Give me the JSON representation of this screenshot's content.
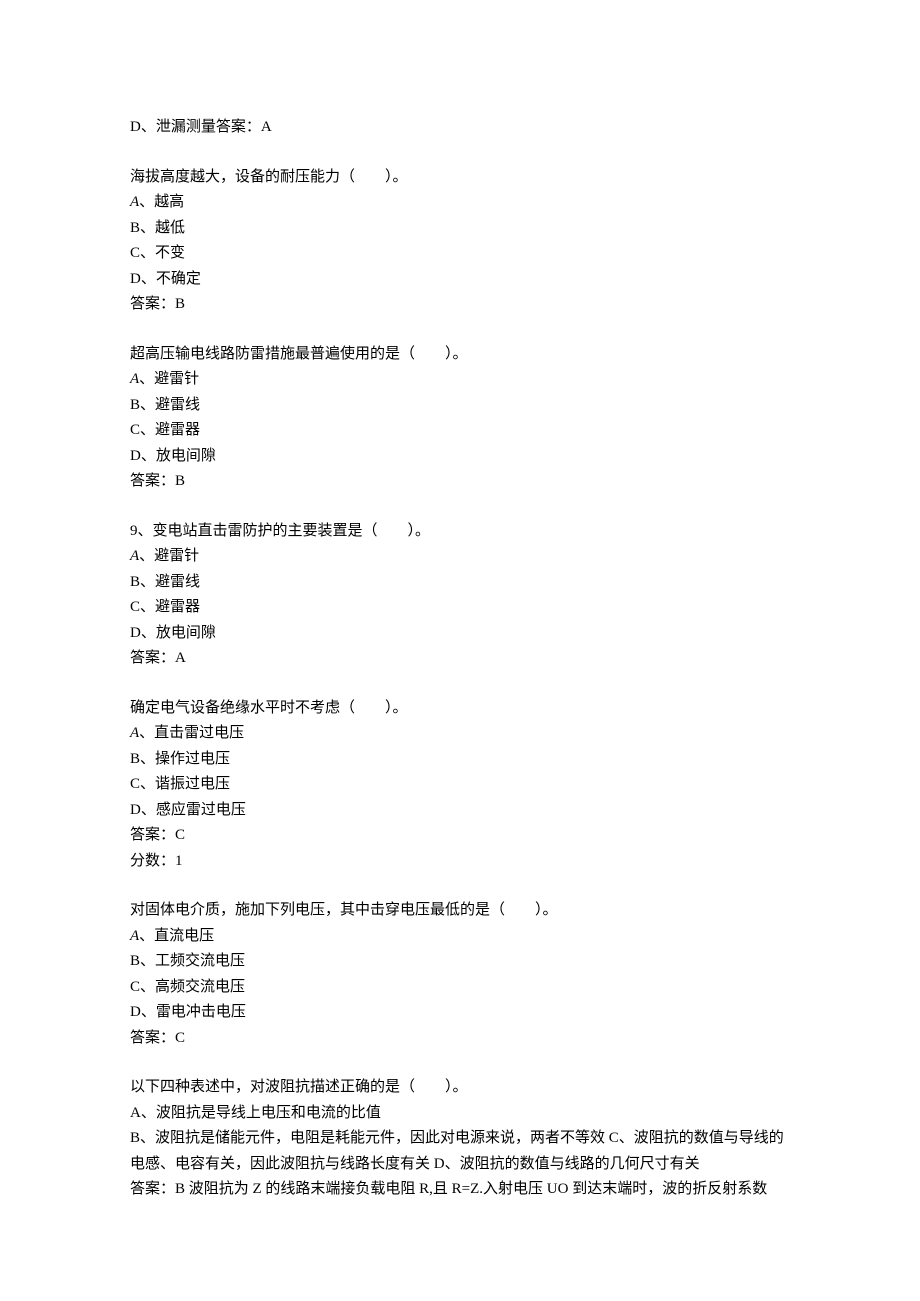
{
  "q1_tail": {
    "optD": "D、泄漏测量答案：A"
  },
  "q2": {
    "stem": "海拔高度越大，设备的耐压能力（　　）。",
    "optA_letter": "A",
    "optA_text": "、越高",
    "optB": "B、越低",
    "optC": "C、不变",
    "optD": "D、不确定",
    "answer": "答案：B"
  },
  "q3": {
    "stem": "超高压输电线路防雷措施最普遍使用的是（　　）。",
    "optA_letter": "A",
    "optA_text": "、避雷针",
    "optB": "B、避雷线",
    "optC": "C、避雷器",
    "optD": "D、放电间隙",
    "answer": "答案：B"
  },
  "q4": {
    "stem": "9、变电站直击雷防护的主要装置是（　　）。",
    "optA_letter": "A",
    "optA_text": "、避雷针",
    "optB": "B、避雷线",
    "optC": "C、避雷器",
    "optD": "D、放电间隙",
    "answer": "答案：A"
  },
  "q5": {
    "stem": "确定电气设备绝缘水平时不考虑（　　）。",
    "optA_letter": "A",
    "optA_text": "、直击雷过电压",
    "optB": "B、操作过电压",
    "optC": "C、谐振过电压",
    "optD": "D、感应雷过电压",
    "answer": "答案：C",
    "score": "分数：1"
  },
  "q6": {
    "stem": "对固体电介质，施加下列电压，其中击穿电压最低的是（　　）。",
    "optA_letter": "A",
    "optA_text": "、直流电压",
    "optB": "B、工频交流电压",
    "optC": "C、高频交流电压",
    "optD": "D、雷电冲击电压",
    "answer": "答案：C"
  },
  "q7": {
    "stem": "以下四种表述中，对波阻抗描述正确的是（　　）。",
    "optA": "A、波阻抗是导线上电压和电流的比值",
    "optBCD": "B、波阻抗是储能元件，电阻是耗能元件，因此对电源来说，两者不等效 C、波阻抗的数值与导线的电感、电容有关，因此波阻抗与线路长度有关 D、波阻抗的数值与线路的几何尺寸有关",
    "answer": "答案：B 波阻抗为 Z 的线路末端接负载电阻 R,且 R=Z.入射电压 UO 到达末端时，波的折反射系数"
  }
}
